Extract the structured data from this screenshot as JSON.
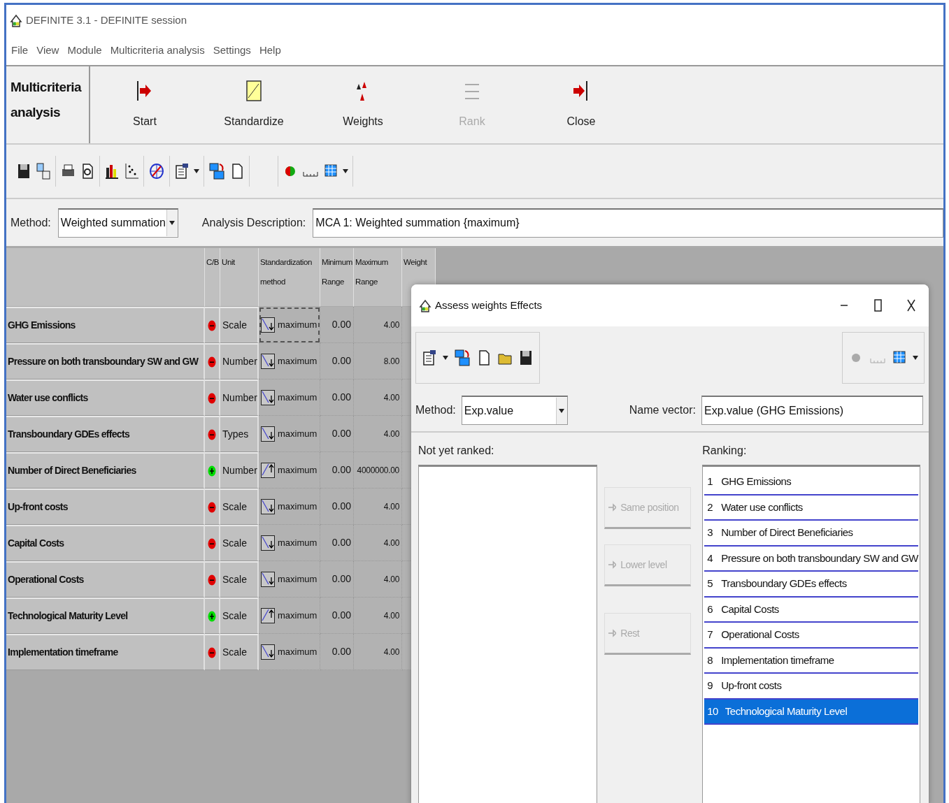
{
  "window": {
    "title": "DEFINITE 3.1 - DEFINITE session"
  },
  "menu": [
    "File",
    "View",
    "Module",
    "Multicriteria analysis",
    "Settings",
    "Help"
  ],
  "module": {
    "title": "Multicriteria analysis",
    "buttons": [
      {
        "label": "Start",
        "disabled": false
      },
      {
        "label": "Standardize",
        "disabled": false
      },
      {
        "label": "Weights",
        "disabled": false
      },
      {
        "label": "Rank",
        "disabled": true
      },
      {
        "label": "Close",
        "disabled": false
      }
    ]
  },
  "method": {
    "label": "Method:",
    "value": "Weighted summation"
  },
  "description": {
    "label": "Analysis Description:",
    "value": "MCA 1: Weighted summation {maximum}"
  },
  "table": {
    "columns": [
      "C/B",
      "Unit",
      "Standardization method",
      "Minimum Range",
      "Maximum Range",
      "Weight"
    ],
    "rows": [
      {
        "name": "GHG Emissions",
        "benefit": false,
        "unit": "Scale",
        "increasing": false,
        "method": "maximum",
        "focused": true,
        "min": "0.00",
        "max": "4.00"
      },
      {
        "name": "Pressure on both transboundary SW and GW",
        "benefit": false,
        "unit": "Number",
        "increasing": false,
        "method": "maximum",
        "focused": false,
        "min": "0.00",
        "max": "8.00"
      },
      {
        "name": "Water use conflicts",
        "benefit": false,
        "unit": "Number",
        "increasing": false,
        "method": "maximum",
        "focused": false,
        "min": "0.00",
        "max": "4.00"
      },
      {
        "name": "Transboundary GDEs effects",
        "benefit": false,
        "unit": "Types",
        "increasing": false,
        "method": "maximum",
        "focused": false,
        "min": "0.00",
        "max": "4.00"
      },
      {
        "name": "Number of Direct  Beneficiaries",
        "benefit": true,
        "unit": "Number",
        "increasing": true,
        "method": "maximum",
        "focused": false,
        "min": "0.00",
        "max": "4000000.00"
      },
      {
        "name": "Up-front costs",
        "benefit": false,
        "unit": "Scale",
        "increasing": false,
        "method": "maximum",
        "focused": false,
        "min": "0.00",
        "max": "4.00"
      },
      {
        "name": "Capital Costs",
        "benefit": false,
        "unit": "Scale",
        "increasing": false,
        "method": "maximum",
        "focused": false,
        "min": "0.00",
        "max": "4.00"
      },
      {
        "name": "Operational Costs",
        "benefit": false,
        "unit": "Scale",
        "increasing": false,
        "method": "maximum",
        "focused": false,
        "min": "0.00",
        "max": "4.00"
      },
      {
        "name": "Technological Maturity Level",
        "benefit": true,
        "unit": "Scale",
        "increasing": true,
        "method": "maximum",
        "focused": false,
        "min": "0.00",
        "max": "4.00"
      },
      {
        "name": "Implementation timeframe",
        "benefit": false,
        "unit": "Scale",
        "increasing": false,
        "method": "maximum",
        "focused": false,
        "min": "0.00",
        "max": "4.00"
      }
    ]
  },
  "dialog": {
    "title": "Assess weights Effects",
    "method": {
      "label": "Method:",
      "value": "Exp.value"
    },
    "name_vector": {
      "label": "Name vector:",
      "value": "Exp.value (GHG Emissions)"
    },
    "not_ranked": {
      "label": "Not yet ranked:"
    },
    "buttons": [
      {
        "label": "Same position",
        "disabled": true
      },
      {
        "label": "Lower level",
        "disabled": true
      },
      {
        "label": "Rest",
        "disabled": true
      }
    ],
    "ranking": {
      "label": "Ranking:",
      "items": [
        {
          "rank": "1",
          "name": "GHG Emissions",
          "selected": false
        },
        {
          "rank": "2",
          "name": "Water use conflicts",
          "selected": false
        },
        {
          "rank": "3",
          "name": "Number of Direct  Beneficiaries",
          "selected": false
        },
        {
          "rank": "4",
          "name": "Pressure on both transboundary SW and GW",
          "selected": false
        },
        {
          "rank": "5",
          "name": "Transboundary GDEs effects",
          "selected": false
        },
        {
          "rank": "6",
          "name": "Capital Costs",
          "selected": false
        },
        {
          "rank": "7",
          "name": "Operational Costs",
          "selected": false
        },
        {
          "rank": "8",
          "name": "Implementation timeframe",
          "selected": false
        },
        {
          "rank": "9",
          "name": "Up-front costs",
          "selected": false
        },
        {
          "rank": "10",
          "name": "Technological Maturity Level",
          "selected": true
        }
      ]
    }
  }
}
